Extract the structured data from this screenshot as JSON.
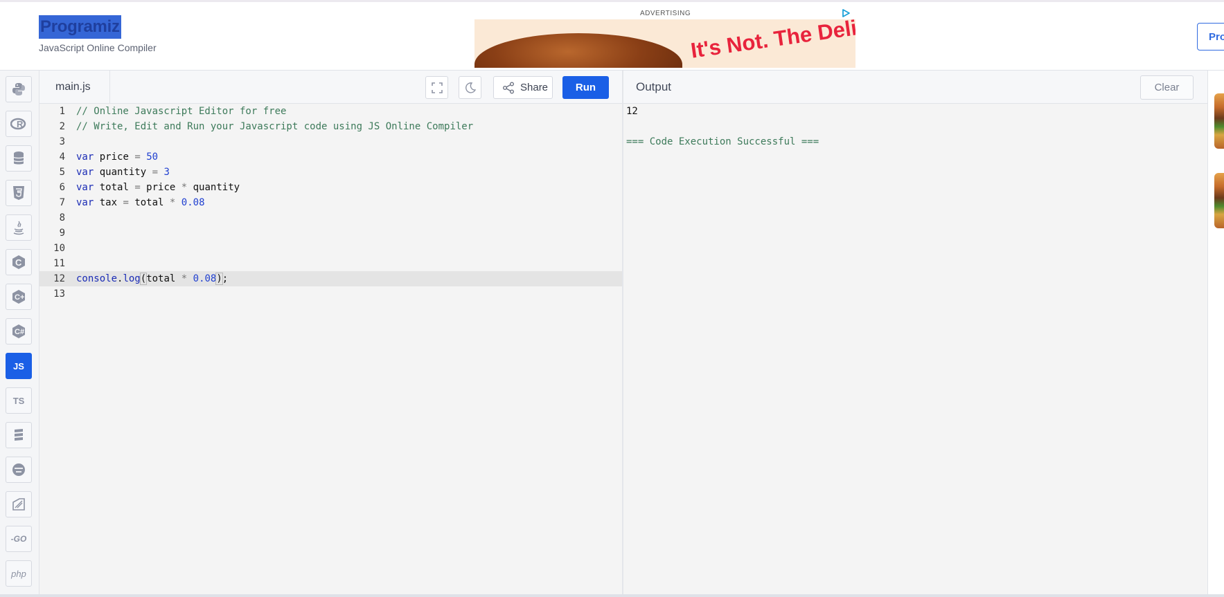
{
  "header": {
    "logo": "Programiz",
    "subtitle": "JavaScript Online Compiler",
    "ad_label": "ADVERTISING",
    "ad_text": "It's Not. The Deli,",
    "pro_button": "Pro"
  },
  "sidebar": {
    "languages": [
      {
        "name": "python",
        "icon": "python-icon"
      },
      {
        "name": "r",
        "icon": "r-icon"
      },
      {
        "name": "sql",
        "icon": "database-icon"
      },
      {
        "name": "html",
        "icon": "html5-icon"
      },
      {
        "name": "java",
        "icon": "java-icon"
      },
      {
        "name": "c",
        "icon": "c-icon"
      },
      {
        "name": "cpp",
        "icon": "cpp-icon"
      },
      {
        "name": "csharp",
        "icon": "csharp-icon"
      },
      {
        "name": "js",
        "label": "JS",
        "active": true
      },
      {
        "name": "ts",
        "label": "TS"
      },
      {
        "name": "stack",
        "icon": "stack-icon"
      },
      {
        "name": "rust",
        "icon": "rust-icon"
      },
      {
        "name": "kotlin",
        "icon": "kotlin-icon"
      },
      {
        "name": "go",
        "label": "-GO"
      },
      {
        "name": "php",
        "label": "php"
      }
    ],
    "js_label": "JS",
    "ts_label": "TS",
    "go_label": "-GO",
    "php_label": "php"
  },
  "editor": {
    "filename": "main.js",
    "share_label": "Share",
    "run_label": "Run",
    "active_line": 12,
    "lines": [
      "// Online Javascript Editor for free",
      "// Write, Edit and Run your Javascript code using JS Online Compiler",
      "",
      "var price = 50",
      "var quantity = 3",
      "var total = price * quantity",
      "var tax = total * 0.08",
      "",
      "",
      "",
      "",
      "console.log(total * 0.08);",
      ""
    ],
    "line_numbers": [
      "1",
      "2",
      "3",
      "4",
      "5",
      "6",
      "7",
      "8",
      "9",
      "10",
      "11",
      "12",
      "13"
    ]
  },
  "output": {
    "title": "Output",
    "clear_label": "Clear",
    "lines": [
      "12",
      "",
      "=== Code Execution Successful ==="
    ]
  },
  "colors": {
    "accent": "#1a5fe6",
    "comment": "#3d7a5a",
    "keyword": "#1a2bb5"
  }
}
